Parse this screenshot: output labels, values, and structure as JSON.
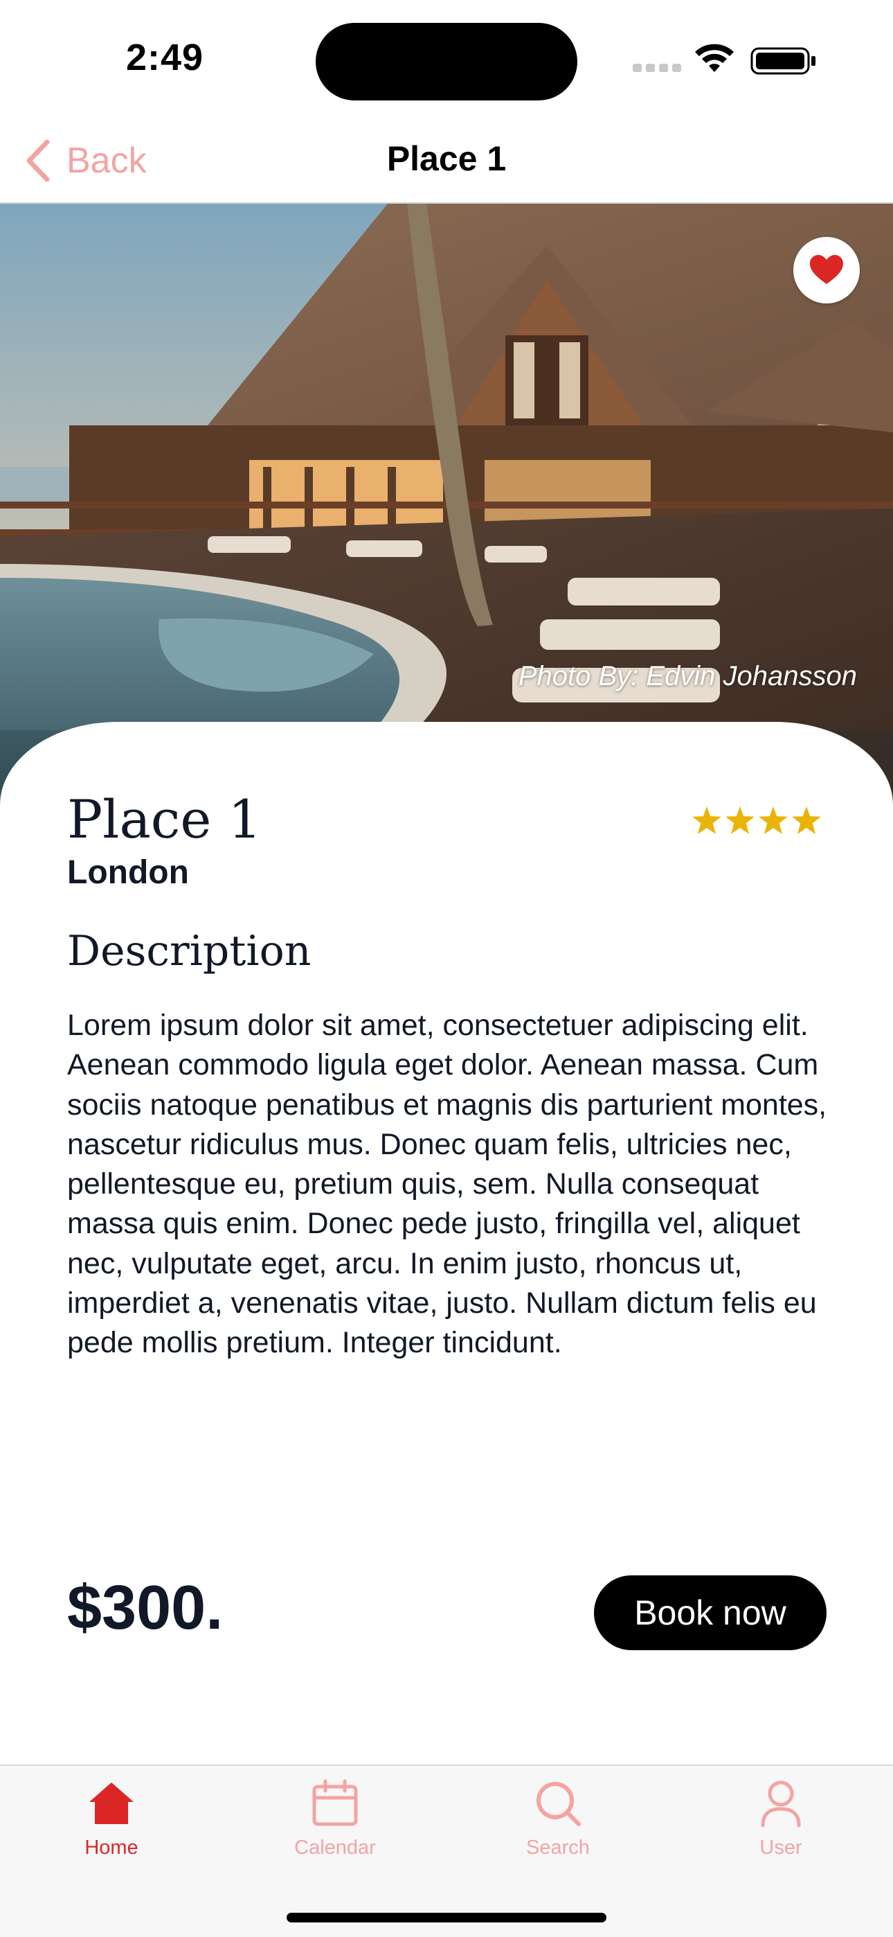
{
  "status_bar": {
    "time": "2:49"
  },
  "nav": {
    "back_label": "Back",
    "title": "Place 1"
  },
  "hero": {
    "photo_credit": "Photo By: Edvin Johansson",
    "favorite_icon": "heart-icon",
    "favorited": true
  },
  "place": {
    "name": "Place 1",
    "city": "London",
    "rating": 4,
    "description_heading": "Description",
    "description": "Lorem ipsum dolor sit amet, consectetuer adipiscing elit. Aenean commodo ligula eget dolor. Aenean massa. Cum sociis natoque penatibus et magnis dis parturient montes, nascetur ridiculus mus. Donec quam felis, ultricies nec, pellentesque eu, pretium quis, sem. Nulla consequat massa quis enim. Donec pede justo, fringilla vel, aliquet nec, vulputate eget, arcu. In enim justo, rhoncus ut, imperdiet a, venenatis vitae, justo. Nullam dictum felis eu pede mollis pretium. Integer tincidunt.",
    "price": "$300.",
    "book_label": "Book now"
  },
  "tabs": [
    {
      "label": "Home",
      "icon": "home-icon",
      "active": true
    },
    {
      "label": "Calendar",
      "icon": "calendar-icon",
      "active": false
    },
    {
      "label": "Search",
      "icon": "search-icon",
      "active": false
    },
    {
      "label": "User",
      "icon": "user-icon",
      "active": false
    }
  ],
  "colors": {
    "accent": "#dc2626",
    "accent_light": "#f4a3a3",
    "star": "#eab308",
    "text": "#111827"
  }
}
